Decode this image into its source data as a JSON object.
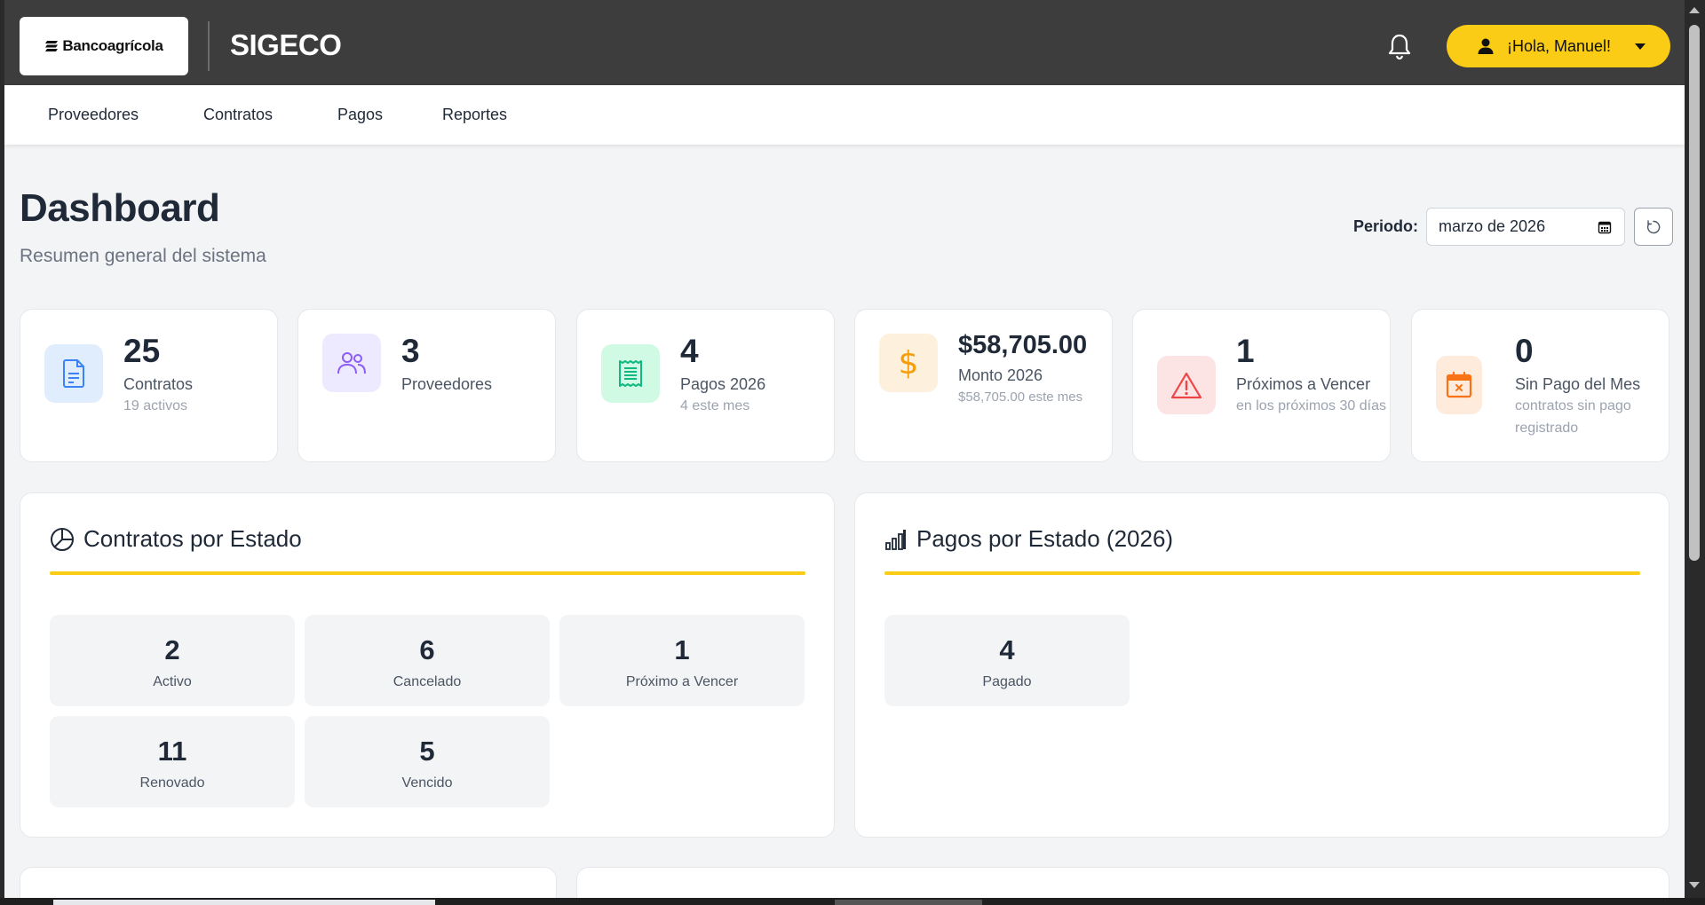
{
  "header": {
    "brand_logo_text": "Bancoagrícola",
    "app_name": "SIGECO",
    "user_greeting": "¡Hola, Manuel!",
    "icons": {
      "notifications": "bell-icon",
      "user": "person-icon",
      "dropdown": "caret-down-icon"
    },
    "accent_color": "#facc15"
  },
  "nav": {
    "items": [
      {
        "label": "Proveedores"
      },
      {
        "label": "Contratos"
      },
      {
        "label": "Pagos"
      },
      {
        "label": "Reportes"
      }
    ]
  },
  "page": {
    "title": "Dashboard",
    "subtitle": "Resumen general del sistema",
    "period_label": "Periodo:",
    "period_value": "marzo de 2026"
  },
  "stats": [
    {
      "value": "25",
      "label": "Contratos",
      "sub": "19 activos",
      "icon": "document-icon",
      "color": "#3b82f6",
      "bg": "#e0edfd"
    },
    {
      "value": "3",
      "label": "Proveedores",
      "sub": "",
      "icon": "users-icon",
      "color": "#8b5cf6",
      "bg": "#ede9fe"
    },
    {
      "value": "4",
      "label": "Pagos 2026",
      "sub": "4 este mes",
      "icon": "receipt-icon",
      "color": "#10b981",
      "bg": "#d1fae5"
    },
    {
      "value": "$58,705.00",
      "label": "Monto 2026",
      "sub": "$58,705.00 este mes",
      "icon": "dollar-icon",
      "color": "#f59e0b",
      "bg": "#fdf1de"
    },
    {
      "value": "1",
      "label": "Próximos a Vencer",
      "sub": "en los próximos 30 días",
      "icon": "warning-icon",
      "color": "#ef4444",
      "bg": "#fde4e4"
    },
    {
      "value": "0",
      "label": "Sin Pago del Mes",
      "sub": "contratos sin pago registrado",
      "icon": "calendar-x-icon",
      "color": "#f97316",
      "bg": "#feebdc"
    }
  ],
  "contracts_panel": {
    "title": "Contratos por Estado",
    "icon": "pie-chart-icon",
    "tiles": [
      {
        "count": "2",
        "label": "Activo"
      },
      {
        "count": "6",
        "label": "Cancelado"
      },
      {
        "count": "1",
        "label": "Próximo a Vencer"
      },
      {
        "count": "11",
        "label": "Renovado"
      },
      {
        "count": "5",
        "label": "Vencido"
      }
    ]
  },
  "payments_panel": {
    "title": "Pagos por Estado (2026)",
    "icon": "bar-chart-icon",
    "tiles": [
      {
        "count": "4",
        "label": "Pagado"
      }
    ]
  }
}
